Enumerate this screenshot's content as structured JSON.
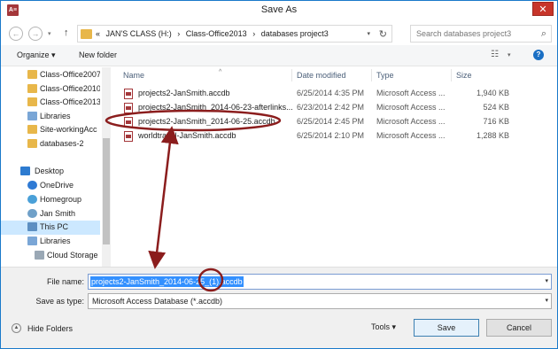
{
  "window": {
    "title": "Save As",
    "app_icon_text": "A≡",
    "close_glyph": "✕"
  },
  "nav": {
    "back_glyph": "←",
    "forward_glyph": "→",
    "dropdown_glyph": "▾",
    "up_glyph": "↑"
  },
  "address": {
    "crumbs": [
      "«",
      "JAN'S CLASS (H:)",
      "›",
      "Class-Office2013",
      "›",
      "databases project3"
    ],
    "dropdown_glyph": "▾",
    "refresh_glyph": "↻"
  },
  "search": {
    "placeholder": "Search databases project3",
    "icon_glyph": "⌕"
  },
  "toolbar": {
    "organize_label": "Organize ▾",
    "new_folder_label": "New folder",
    "view_glyph": "☷",
    "view_dropdown_glyph": "▾",
    "help_glyph": "?"
  },
  "navpane": {
    "items": [
      {
        "label": "Class-Office2007",
        "icon": "folder-icon"
      },
      {
        "label": "Class-Office2010",
        "icon": "folder-icon"
      },
      {
        "label": "Class-Office2013",
        "icon": "folder-icon"
      },
      {
        "label": "Libraries",
        "icon": "libraries-icon"
      },
      {
        "label": "Site-workingAcc",
        "icon": "folder-icon"
      },
      {
        "label": "databases-2",
        "icon": "folder-icon"
      },
      {
        "label": "Desktop",
        "icon": "desktop-icon"
      },
      {
        "label": "OneDrive",
        "icon": "cloud-icon"
      },
      {
        "label": "Homegroup",
        "icon": "homegroup-icon"
      },
      {
        "label": "Jan Smith",
        "icon": "user-icon"
      },
      {
        "label": "This PC",
        "icon": "computer-icon"
      },
      {
        "label": "Libraries",
        "icon": "libraries-icon"
      },
      {
        "label": "Cloud Storage",
        "icon": "drive-icon"
      }
    ]
  },
  "filelist": {
    "columns": [
      "Name",
      "Date modified",
      "Type",
      "Size"
    ],
    "sort_glyph": "^",
    "files": [
      {
        "name": "projects2-JanSmith.accdb",
        "date": "6/25/2014 4:35 PM",
        "type": "Microsoft Access ...",
        "size": "1,940 KB"
      },
      {
        "name": "projects2-JanSmith_2014-06-23-afterlinks...",
        "date": "6/23/2014 2:42 PM",
        "type": "Microsoft Access ...",
        "size": "524 KB"
      },
      {
        "name": "projects2-JanSmith_2014-06-25.accdb",
        "date": "6/25/2014 2:45 PM",
        "type": "Microsoft Access ...",
        "size": "716 KB"
      },
      {
        "name": "worldtravel-JanSmith.accdb",
        "date": "6/25/2014 2:10 PM",
        "type": "Microsoft Access ...",
        "size": "1,288 KB"
      }
    ]
  },
  "form": {
    "filename_label": "File name:",
    "filename_value": "projects2-JanSmith_2014-06-25_(1).accdb",
    "savetype_label": "Save as type:",
    "savetype_value": "Microsoft Access Database (*.accdb)",
    "dropdown_glyph": "▾"
  },
  "footer": {
    "hide_folders_label": "Hide Folders",
    "hide_icon_glyph": "▲",
    "tools_label": "Tools ▾",
    "save_label": "Save",
    "cancel_label": "Cancel"
  },
  "annotation": {
    "color": "#8b1d1d"
  }
}
